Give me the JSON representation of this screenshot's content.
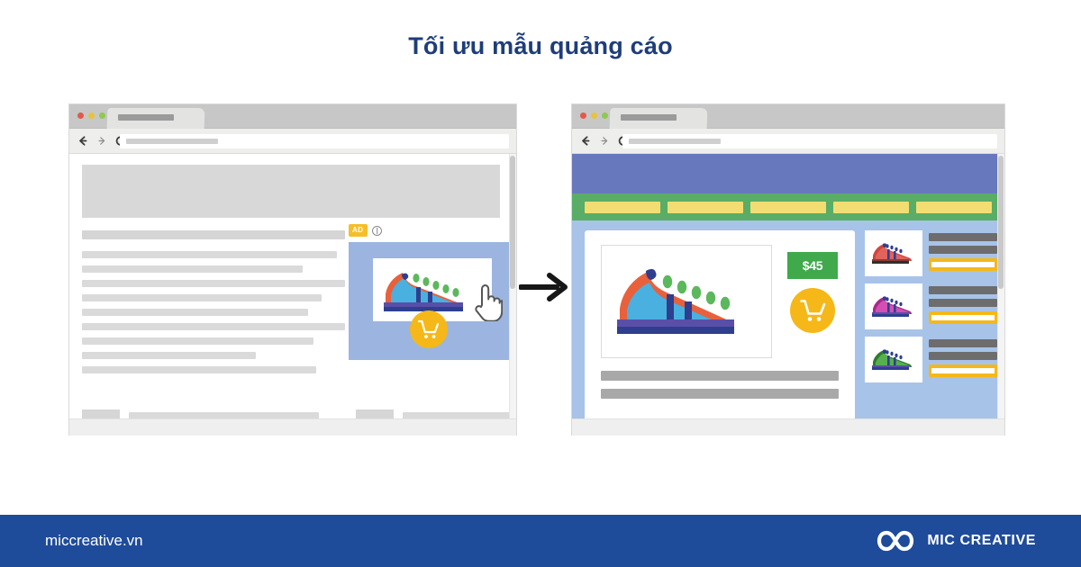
{
  "page": {
    "title": "Tối ưu mẫu quảng cáo",
    "title_color": "#1f3d7a",
    "background": "#ffffff"
  },
  "flow": {
    "arrow_icon": "arrow-right-icon",
    "direction": "left-to-right"
  },
  "left_window": {
    "name": "article-page-with-display-ad",
    "chrome": {
      "traffic_lights": [
        "#e05a4c",
        "#e8c33c",
        "#8fc94e"
      ],
      "tab_label": "",
      "back_icon": "arrow-left-icon",
      "forward_icon": "arrow-right-icon",
      "reload_icon": "reload-icon",
      "address_value": "",
      "address_placeholder": ""
    },
    "content": {
      "hero_placeholder": "",
      "article_lines": [
        100,
        97,
        84,
        100,
        91,
        86,
        100,
        88,
        66,
        89
      ],
      "lower_left_lines": [
        88,
        88,
        100,
        86
      ],
      "lower_right_lines": [
        92,
        92,
        100,
        78
      ]
    },
    "ad": {
      "badge_label": "AD",
      "badge_color": "#f5bf28",
      "info_icon": "info-icon",
      "panel_color": "#9bb5e0",
      "shoe_icon": "shoe-blue-icon",
      "cursor_icon": "hand-cursor-icon",
      "cart_icon": "shopping-cart-icon",
      "cart_color": "#f5b818"
    }
  },
  "right_window": {
    "name": "optimized-product-landing-page",
    "chrome": {
      "traffic_lights": [
        "#e05a4c",
        "#e8c33c",
        "#8fc94e"
      ],
      "tab_label": "",
      "back_icon": "arrow-left-icon",
      "forward_icon": "arrow-right-icon",
      "reload_icon": "reload-icon",
      "address_value": "",
      "address_placeholder": ""
    },
    "shop": {
      "header_color": "#6778bd",
      "nav_color": "#59ad66",
      "nav_items": [
        "",
        "",
        "",
        "",
        ""
      ],
      "nav_item_color": "#f2dd72",
      "body_color": "#a8c3e8",
      "product": {
        "image_icon": "shoe-blue-icon",
        "price_label": "$45",
        "price_color": "#3fa94c",
        "cart_icon": "shopping-cart-icon",
        "cart_color": "#f5b818",
        "description_lines": [
          100,
          100
        ]
      },
      "related_products": [
        {
          "thumb_icon": "shoe-red-icon",
          "color": "#d0453f",
          "bars": [
            "",
            ""
          ],
          "button_label": ""
        },
        {
          "thumb_icon": "shoe-magenta-icon",
          "color": "#c1369c",
          "bars": [
            "",
            ""
          ],
          "button_label": ""
        },
        {
          "thumb_icon": "shoe-green-icon",
          "color": "#4b9b44",
          "bars": [
            "",
            ""
          ],
          "button_label": ""
        }
      ]
    }
  },
  "footer": {
    "background": "#1f4b9b",
    "url": "miccreative.vn",
    "logo_icon": "mic-infinity-logo-icon",
    "brand_name": "MIC CREATIVE"
  }
}
